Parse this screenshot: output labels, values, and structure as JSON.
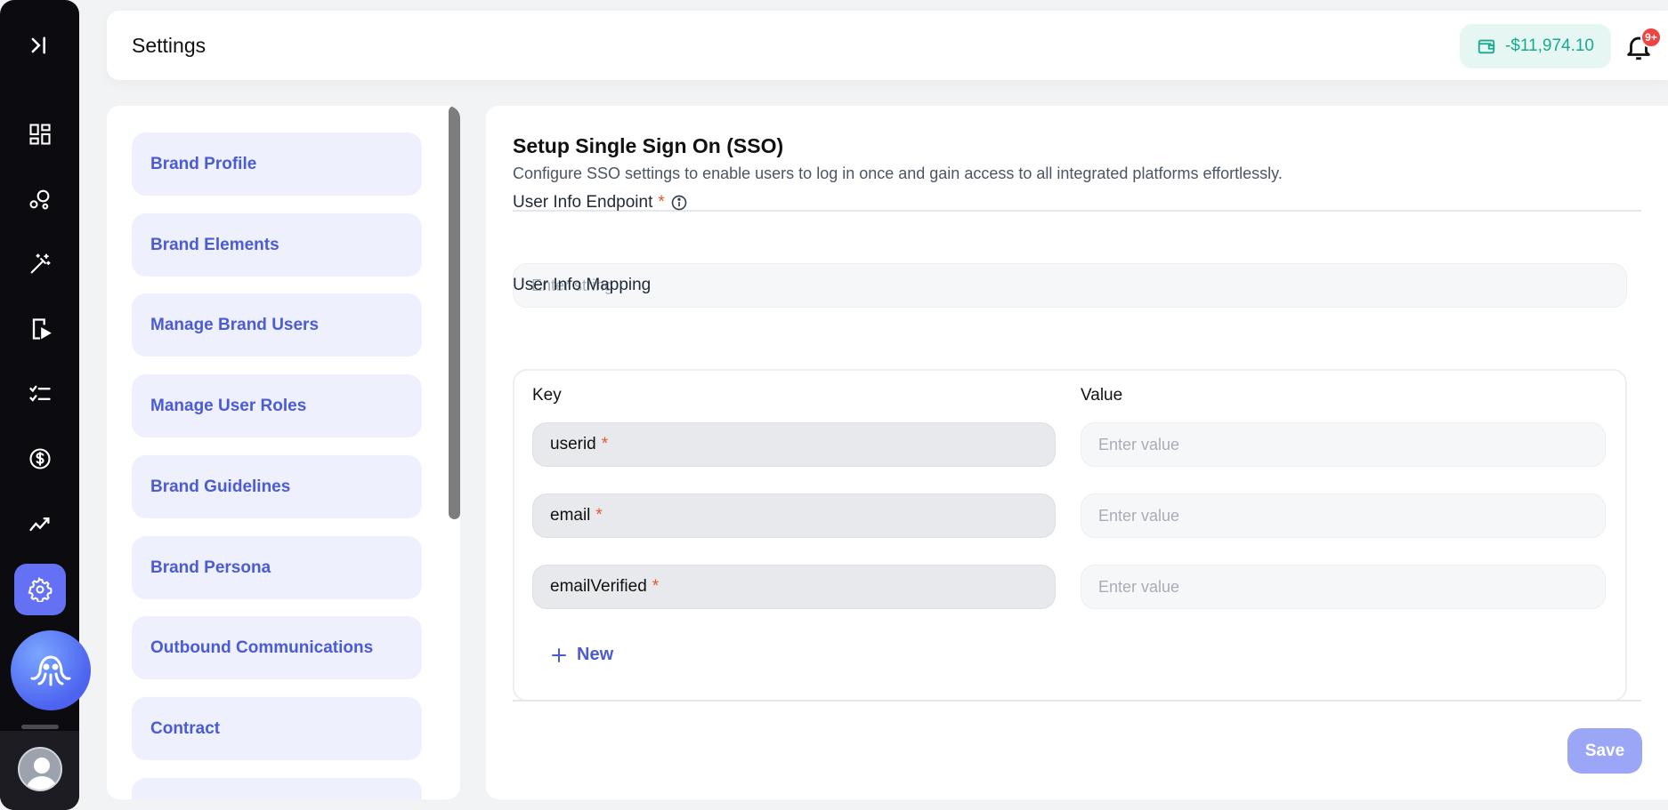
{
  "header": {
    "title": "Settings",
    "wallet_amount": "-$11,974.10",
    "notification_badge": "9+"
  },
  "rail": {
    "items": [
      "expand-icon",
      "dashboard-icon",
      "nodes-icon",
      "magic-wand-icon",
      "mobile-play-icon",
      "checklist-icon",
      "dollar-icon",
      "analytics-icon",
      "settings-icon"
    ],
    "active": "settings-icon"
  },
  "nav": {
    "items": [
      {
        "label": "Brand Profile"
      },
      {
        "label": "Brand Elements"
      },
      {
        "label": "Manage Brand Users"
      },
      {
        "label": "Manage User Roles"
      },
      {
        "label": "Brand Guidelines"
      },
      {
        "label": "Brand Persona"
      },
      {
        "label": "Outbound Communications"
      },
      {
        "label": "Contract"
      },
      {
        "label": ""
      }
    ]
  },
  "main": {
    "title": "Setup Single Sign On (SSO)",
    "subtitle": "Configure SSO settings to enable users to log in once and gain access to all integrated platforms effortlessly.",
    "endpoint_label": "User Info Endpoint",
    "required_mark": "*",
    "endpoint_placeholder": "Enter string",
    "mapping_label": "User Info Mapping",
    "key_header": "Key",
    "value_header": "Value",
    "mappings": [
      {
        "key": "userid",
        "value_placeholder": "Enter value"
      },
      {
        "key": "email",
        "value_placeholder": "Enter value"
      },
      {
        "key": "emailVerified",
        "value_placeholder": "Enter value"
      }
    ],
    "new_label": "New",
    "save_label": "Save"
  },
  "colors": {
    "accent": "#4a5bd4",
    "nav_bg": "#eef0fd",
    "wallet_text": "#19a98e",
    "required": "#e4572e",
    "save_bg": "#9ba6f6"
  }
}
